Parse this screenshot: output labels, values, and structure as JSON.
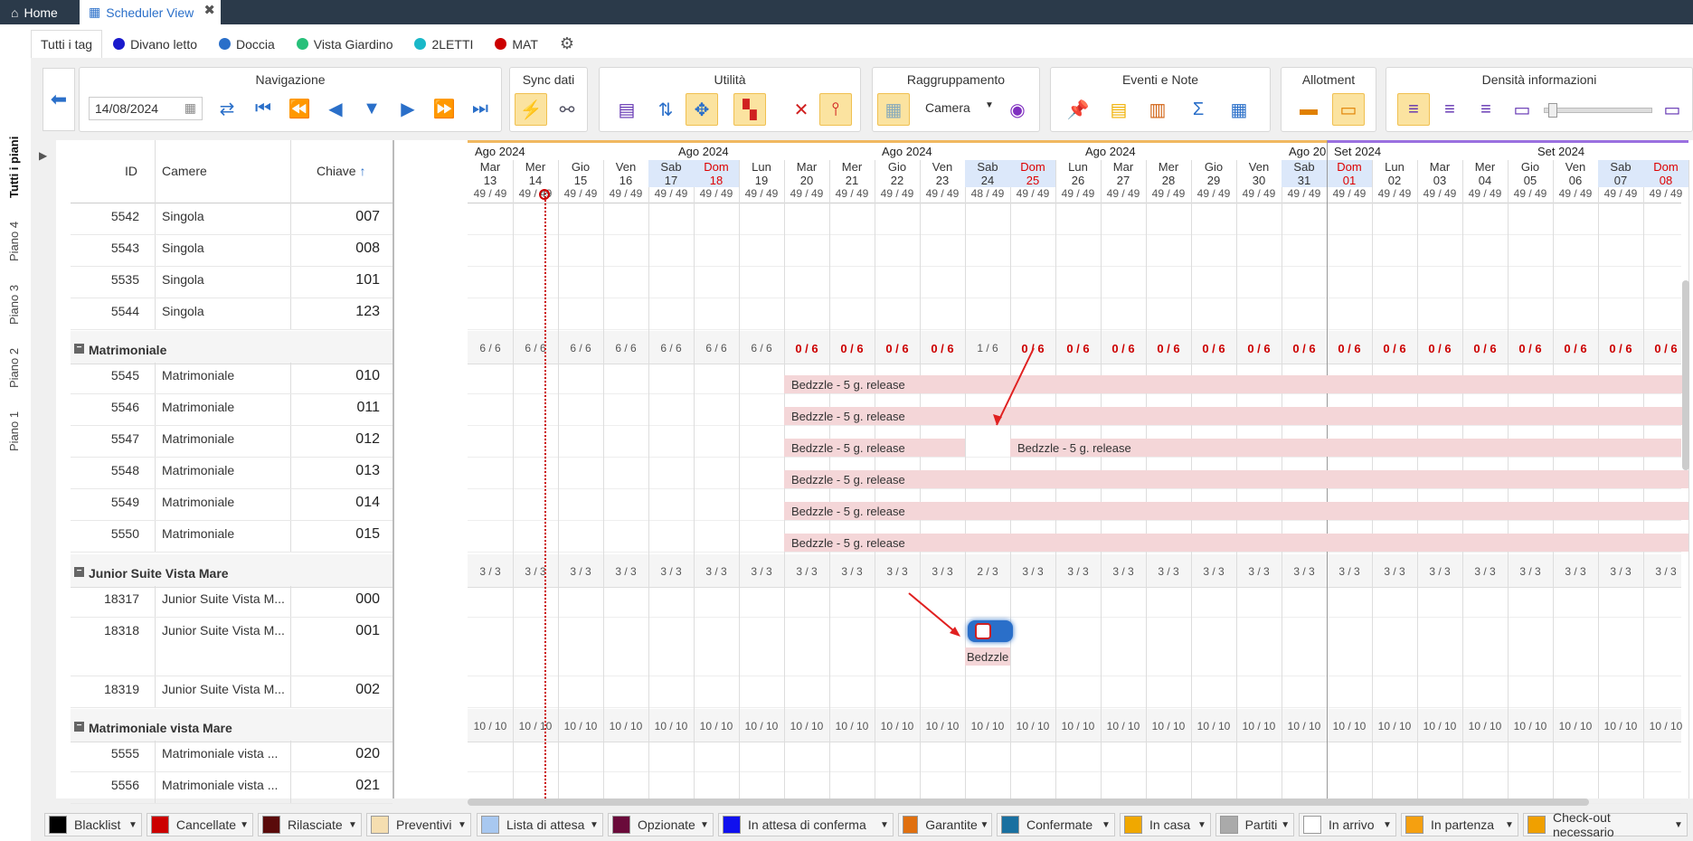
{
  "tabs": {
    "home": "Home",
    "scheduler": "Scheduler View"
  },
  "tags": [
    {
      "label": "Tutti i tag"
    },
    {
      "label": "Divano letto",
      "color": "#1a1acc"
    },
    {
      "label": "Doccia",
      "color": "#2a6fc9"
    },
    {
      "label": "Vista Giardino",
      "color": "#27c07a"
    },
    {
      "label": "2LETTI",
      "color": "#1ab8c8"
    },
    {
      "label": "MAT",
      "color": "#cc0000"
    }
  ],
  "floors": [
    "Tutti i piani",
    "Piano 4",
    "Piano 3",
    "Piano 2",
    "Piano 1"
  ],
  "toolbar": {
    "nav": "Navigazione",
    "date": "14/08/2024",
    "sync": "Sync dati",
    "util": "Utilità",
    "group": "Raggruppamento",
    "group_value": "Camera",
    "events": "Eventi e Note",
    "allot": "Allotment",
    "density": "Densità informazioni"
  },
  "columns": {
    "id": "ID",
    "rooms": "Camere",
    "key": "Chiave"
  },
  "months": {
    "ago": "Ago 2024",
    "ago_cut": "Ago 20",
    "set": "Set 2024"
  },
  "days": [
    [
      "Mar",
      "13"
    ],
    [
      "Mer",
      "14"
    ],
    [
      "Gio",
      "15"
    ],
    [
      "Ven",
      "16"
    ],
    [
      "Sab",
      "17"
    ],
    [
      "Dom",
      "18"
    ],
    [
      "Lun",
      "19"
    ],
    [
      "Mar",
      "20"
    ],
    [
      "Mer",
      "21"
    ],
    [
      "Gio",
      "22"
    ],
    [
      "Ven",
      "23"
    ],
    [
      "Sab",
      "24"
    ],
    [
      "Dom",
      "25"
    ],
    [
      "Lun",
      "26"
    ],
    [
      "Mar",
      "27"
    ],
    [
      "Mer",
      "28"
    ],
    [
      "Gio",
      "29"
    ],
    [
      "Ven",
      "30"
    ],
    [
      "Sab",
      "31"
    ],
    [
      "Dom",
      "01"
    ],
    [
      "Lun",
      "02"
    ],
    [
      "Mar",
      "03"
    ],
    [
      "Mer",
      "04"
    ],
    [
      "Gio",
      "05"
    ],
    [
      "Ven",
      "06"
    ],
    [
      "Sab",
      "07"
    ],
    [
      "Dom",
      "08"
    ]
  ],
  "avail": [
    "49 / 49",
    "49 / 49",
    "49 / 49",
    "49 / 49",
    "49 / 49",
    "49 / 49",
    "49 / 49",
    "49 / 49",
    "49 / 49",
    "49 / 49",
    "49 / 49",
    "48 / 49",
    "49 / 49",
    "49 / 49",
    "49 / 49",
    "49 / 49",
    "49 / 49",
    "49 / 49",
    "49 / 49",
    "49 / 49",
    "49 / 49",
    "49 / 49",
    "49 / 49",
    "49 / 49",
    "49 / 49",
    "49 / 49",
    "49 / 49"
  ],
  "rows_top": [
    {
      "id": "5542",
      "cam": "Singola",
      "key": "007"
    },
    {
      "id": "5543",
      "cam": "Singola",
      "key": "008"
    },
    {
      "id": "5535",
      "cam": "Singola",
      "key": "101"
    },
    {
      "id": "5544",
      "cam": "Singola",
      "key": "123"
    }
  ],
  "groups": [
    {
      "name": "Matrimoniale",
      "sums": [
        "6 / 6",
        "6 / 6",
        "6 / 6",
        "6 / 6",
        "6 / 6",
        "6 / 6",
        "6 / 6",
        "0 / 6",
        "0 / 6",
        "0 / 6",
        "0 / 6",
        "1 / 6",
        "0 / 6",
        "0 / 6",
        "0 / 6",
        "0 / 6",
        "0 / 6",
        "0 / 6",
        "0 / 6",
        "0 / 6",
        "0 / 6",
        "0 / 6",
        "0 / 6",
        "0 / 6",
        "0 / 6",
        "0 / 6",
        "0 / 6"
      ],
      "rows": [
        {
          "id": "5545",
          "cam": "Matrimoniale",
          "key": "010"
        },
        {
          "id": "5546",
          "cam": "Matrimoniale",
          "key": "011"
        },
        {
          "id": "5547",
          "cam": "Matrimoniale",
          "key": "012"
        },
        {
          "id": "5548",
          "cam": "Matrimoniale",
          "key": "013"
        },
        {
          "id": "5549",
          "cam": "Matrimoniale",
          "key": "014"
        },
        {
          "id": "5550",
          "cam": "Matrimoniale",
          "key": "015"
        }
      ]
    },
    {
      "name": "Junior Suite Vista Mare",
      "sums": [
        "3 / 3",
        "3 / 3",
        "3 / 3",
        "3 / 3",
        "3 / 3",
        "3 / 3",
        "3 / 3",
        "3 / 3",
        "3 / 3",
        "3 / 3",
        "3 / 3",
        "2 / 3",
        "3 / 3",
        "3 / 3",
        "3 / 3",
        "3 / 3",
        "3 / 3",
        "3 / 3",
        "3 / 3",
        "3 / 3",
        "3 / 3",
        "3 / 3",
        "3 / 3",
        "3 / 3",
        "3 / 3",
        "3 / 3",
        "3 / 3"
      ],
      "rows": [
        {
          "id": "18317",
          "cam": "Junior Suite Vista M...",
          "key": "000"
        },
        {
          "id": "18318",
          "cam": "Junior Suite Vista M...",
          "key": "001"
        },
        {
          "id": "18319",
          "cam": "Junior Suite Vista M...",
          "key": "002"
        }
      ]
    },
    {
      "name": "Matrimoniale vista Mare",
      "sums": [
        "10 / 10",
        "10 / 10",
        "10 / 10",
        "10 / 10",
        "10 / 10",
        "10 / 10",
        "10 / 10",
        "10 / 10",
        "10 / 10",
        "10 / 10",
        "10 / 10",
        "10 / 10",
        "10 / 10",
        "10 / 10",
        "10 / 10",
        "10 / 10",
        "10 / 10",
        "10 / 10",
        "10 / 10",
        "10 / 10",
        "10 / 10",
        "10 / 10",
        "10 / 10",
        "10 / 10",
        "10 / 10",
        "10 / 10",
        "10 / 10"
      ],
      "rows": [
        {
          "id": "5555",
          "cam": "Matrimoniale vista ...",
          "key": "020"
        },
        {
          "id": "5556",
          "cam": "Matrimoniale vista ...",
          "key": "021"
        }
      ]
    }
  ],
  "booking_label": "Bedzzle - 5 g. release",
  "booking_short": "Bedzzle",
  "legend": [
    {
      "label": "Blacklist",
      "color": "#000000"
    },
    {
      "label": "Cancellate",
      "color": "#cc0000"
    },
    {
      "label": "Rilasciate",
      "color": "#5a0a0a"
    },
    {
      "label": "Preventivi",
      "color": "#f5deb0"
    },
    {
      "label": "Lista di attesa",
      "color": "#a8c8f0"
    },
    {
      "label": "Opzionate",
      "color": "#6a0a3a"
    },
    {
      "label": "In attesa di conferma",
      "color": "#1010ee"
    },
    {
      "label": "Garantite",
      "color": "#e07010"
    },
    {
      "label": "Confermate",
      "color": "#1a70a0"
    },
    {
      "label": "In casa",
      "color": "#f0a800"
    },
    {
      "label": "Partiti",
      "color": "#aaaaaa"
    },
    {
      "label": "In arrivo",
      "color": "#ffffff"
    },
    {
      "label": "In partenza",
      "color": "#f5a010"
    },
    {
      "label": "Check-out necessario",
      "color": "#f0a000"
    }
  ]
}
